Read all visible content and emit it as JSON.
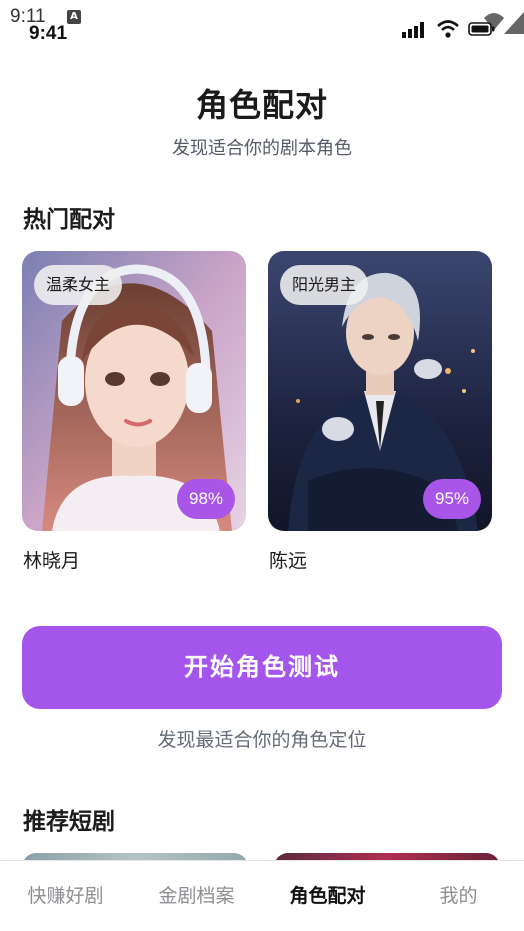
{
  "status_bar": {
    "system_time": "9:11",
    "system_badge": "A",
    "app_time": "9:41",
    "icons": [
      "signal-icon",
      "wifi-icon",
      "battery-icon"
    ]
  },
  "header": {
    "title": "角色配对",
    "subtitle": "发现适合你的剧本角色"
  },
  "hot_pairs": {
    "title": "热门配对",
    "cards": [
      {
        "tag": "温柔女主",
        "match": "98%",
        "name": "林晓月"
      },
      {
        "tag": "阳光男主",
        "match": "95%",
        "name": "陈远"
      }
    ]
  },
  "test": {
    "button_label": "开始角色测试",
    "caption": "发现最适合你的角色定位"
  },
  "recommend": {
    "title": "推荐短剧"
  },
  "tab_bar": {
    "items": [
      "快赚好剧",
      "金剧档案",
      "角色配对",
      "我的"
    ],
    "active_index": 2
  },
  "colors": {
    "accent": "#a456ec",
    "badge": "#a855e8"
  }
}
